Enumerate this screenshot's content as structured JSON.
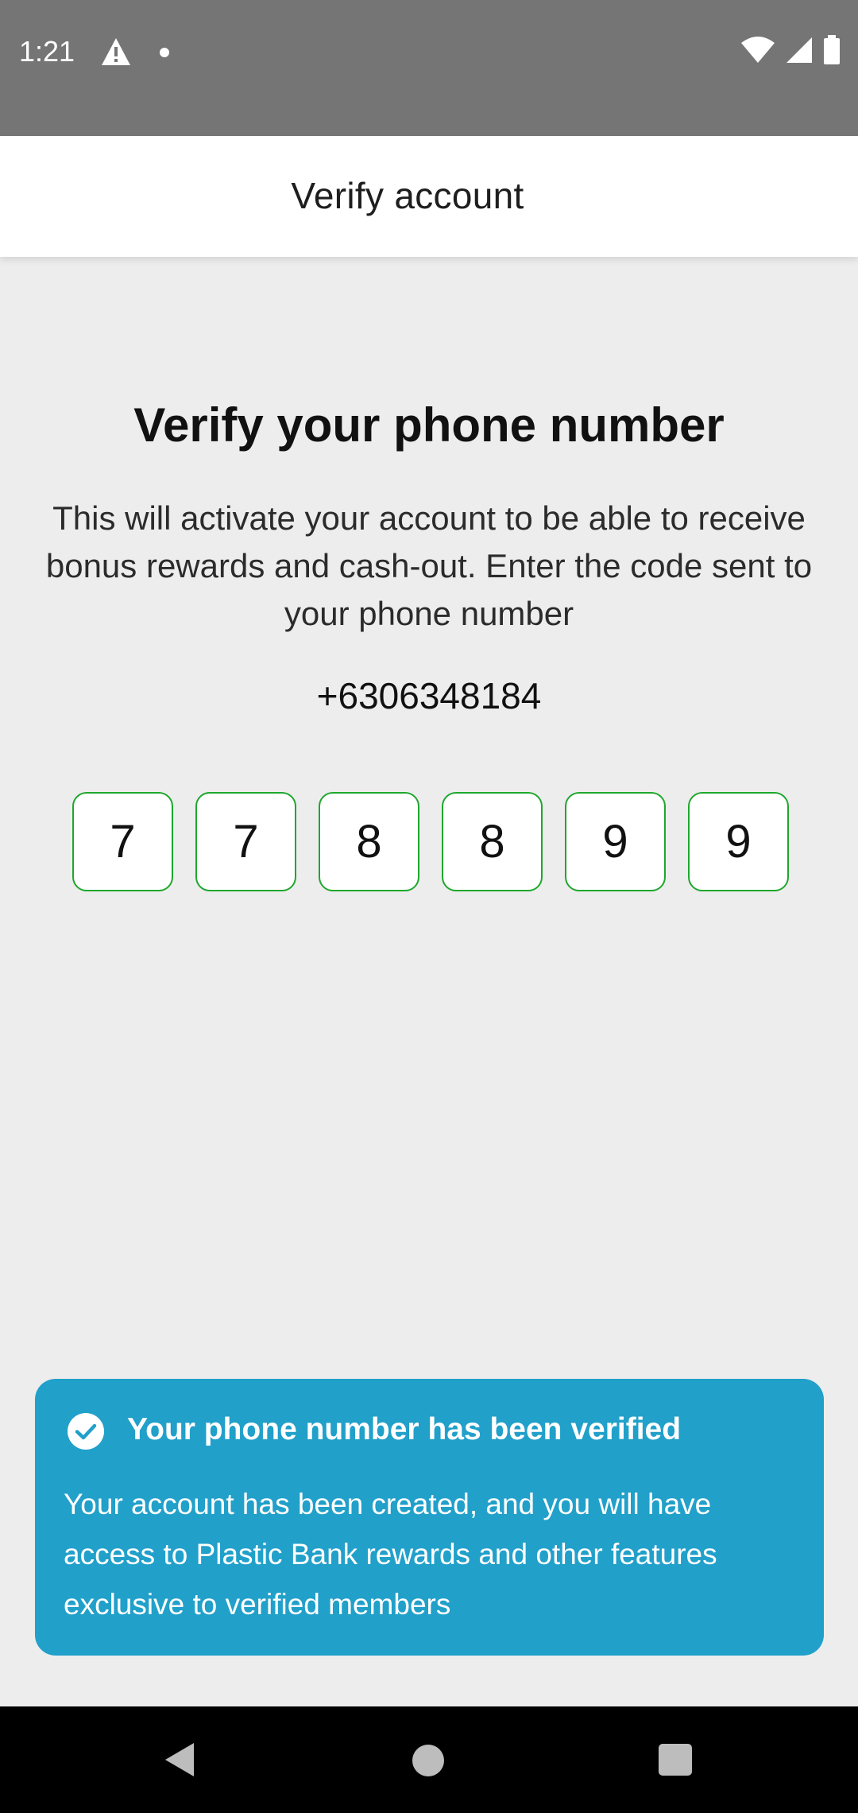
{
  "status_bar": {
    "time": "1:21"
  },
  "app_bar": {
    "title": "Verify account"
  },
  "content": {
    "heading": "Verify your phone number",
    "description": "This will activate your account to be able to receive bonus rewards and cash-out. Enter the code sent to your phone number",
    "phone_number": "+6306348184",
    "otp_digits": [
      "7",
      "7",
      "8",
      "8",
      "9",
      "9"
    ]
  },
  "toast": {
    "title": "Your phone number has been verified",
    "body": "Your account has been created, and you will have access to Plastic Bank rewards and other features exclusive to verified members"
  },
  "colors": {
    "accent_green": "#1fa72d",
    "toast_blue": "#21a0ca",
    "status_bar": "#757575"
  },
  "icons": [
    "warning-icon",
    "notification-dot-icon",
    "wifi-icon",
    "signal-icon",
    "battery-icon",
    "check-circle-icon",
    "back-icon",
    "home-icon",
    "recents-icon"
  ]
}
